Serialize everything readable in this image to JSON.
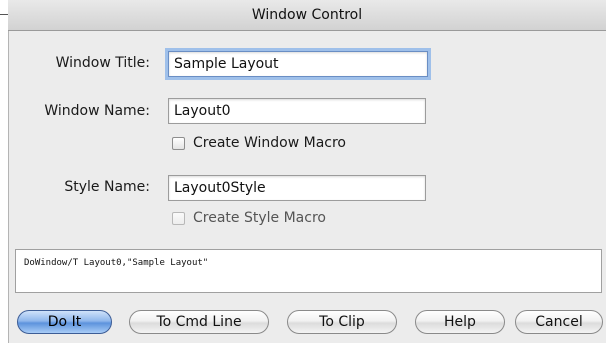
{
  "window": {
    "title": "Window Control"
  },
  "form": {
    "window_title_label": "Window Title:",
    "window_title_value": "Sample Layout",
    "window_name_label": "Window Name:",
    "window_name_value": "Layout0",
    "create_window_macro_label": "Create Window Macro",
    "style_name_label": "Style Name:",
    "style_name_value": "Layout0Style",
    "create_style_macro_label": "Create Style Macro"
  },
  "command_line": {
    "text": "DoWindow/T Layout0,\"Sample Layout\""
  },
  "buttons": {
    "do_it": "Do It",
    "to_cmd_line": "To Cmd Line",
    "to_clip": "To Clip",
    "help": "Help",
    "cancel": "Cancel"
  },
  "colors": {
    "default_button": "#6fa2e6",
    "focus_ring": "#9fc0ea",
    "window_bg": "#ececec"
  }
}
